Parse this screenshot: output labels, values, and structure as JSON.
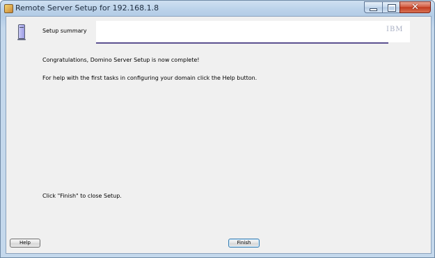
{
  "window": {
    "title": "Remote Server Setup for 192.168.1.8",
    "icon": "app-icon",
    "controls": {
      "minimize_icon": "minimize-icon",
      "maximize_icon": "maximize-icon",
      "close_glyph": "✕"
    }
  },
  "header": {
    "step_icon": "server-icon",
    "step_title": "Setup summary",
    "logo_text": "IBM"
  },
  "content": {
    "message_complete": "Congratulations, Domino Server Setup is now complete!",
    "message_help": "For help with the first tasks in configuring your domain click the Help button.",
    "message_close": "Click \"Finish\" to close Setup."
  },
  "footer": {
    "help_label": "Help",
    "finish_label": "Finish"
  },
  "colors": {
    "banner_bar": "#5a4f8f",
    "client_background": "#f0f0f0",
    "close_button": "#c23b1f"
  }
}
